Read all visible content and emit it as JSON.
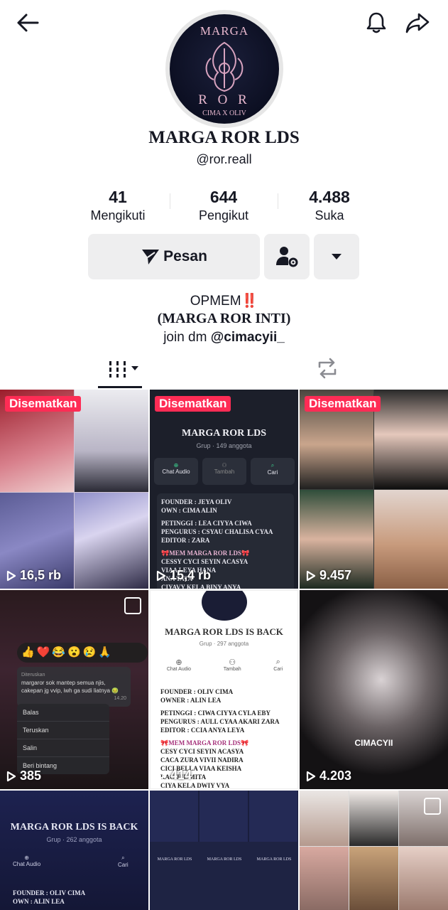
{
  "profile": {
    "avatar_text_top": "MARGA",
    "avatar_text_mid": "R O R",
    "avatar_text_bottom": "CIMA X OLIV",
    "display_name": "MARGA ROR LDS",
    "username": "@ror.reall"
  },
  "stats": [
    {
      "value": "41",
      "label": "Mengikuti"
    },
    {
      "value": "644",
      "label": "Pengikut"
    },
    {
      "value": "4.488",
      "label": "Suka"
    }
  ],
  "actions": {
    "message_label": "Pesan"
  },
  "bio": {
    "line1": "OPMEM",
    "line1_emoji": "‼️",
    "line2": "(MARGA ROR INTI)",
    "line3_prefix": "join dm ",
    "line3_mention": "@cimacyii_"
  },
  "videos": [
    {
      "pinned_label": "Disematkan",
      "views": "16,5 rb"
    },
    {
      "pinned_label": "Disematkan",
      "views": "15,4 rb",
      "group_title": "MARGA ROR LDS",
      "group_sub": "Grup · 149 anggota",
      "btn1": "Chat Audio",
      "btn2": "Tambah",
      "btn3": "Cari",
      "lines": [
        "FOUNDER : JEYA OLIV",
        "OWN : CIMA ALIN",
        "PETINGGI : LEA CIYYA CIWA",
        "PENGURUS : CSYAU CHALISA CYAA",
        "EDITOR : ZARA",
        "🎀MEM MARGA ROR LDS🎀",
        "CESSY CYCI SEYIN ACASYA",
        "VIAA LEYA HANA",
        "ANA TATA",
        "CIYAVY KELA BINY ANYA"
      ]
    },
    {
      "pinned_label": "Disematkan",
      "views": "9.457"
    },
    {
      "views": "385",
      "msg_author": "Diteruskan",
      "msg_text": "margaror sok mantep semua njis, cakepan jg vvip, iwh ga sudi liatnya 🤢",
      "msg_time": "14.20",
      "menu": [
        "Balas",
        "Teruskan",
        "Salin",
        "Beri bintang"
      ]
    },
    {
      "views": "414",
      "group_title": "MARGA ROR LDS IS BACK",
      "group_sub": "Grup · 297 anggota",
      "btn1": "Chat Audio",
      "btn2": "Tambah",
      "btn3": "Cari",
      "lines": [
        "FOUNDER : OLIV CIMA",
        "OWNER : ALIN LEA",
        "PETINGGI : CIWA CIYYA CYLA EBY",
        "PENGURUS : AULL CYAA AKARI ZARA",
        "EDITOR : CCIA ANYA LEYA",
        "🎀MEM MARGA ROR LDS🎀",
        "CESY CYCI SEYIN ACASYA",
        "CACA ZURA VIVII NADIRA",
        "CICI BELLA VIAA KEISHA",
        "RACHEL MITA",
        "CIYA KELA DWIY VYA"
      ]
    },
    {
      "views": "4.203",
      "overlay_text": "CIMACYII"
    },
    {
      "group_title": "MARGA ROR LDS IS BACK",
      "group_sub": "Grup · 262 anggota",
      "btn1": "Chat Audio",
      "btn3": "Cari",
      "lines": [
        "FOUNDER : OLIV CIMA",
        "OWN : ALIN LEA"
      ]
    },
    {
      "mini_title": "MARGA ROR LDS"
    },
    {}
  ],
  "colors": {
    "accent": "#fe2c55",
    "text": "#161823",
    "button_bg": "#eeeeef"
  }
}
